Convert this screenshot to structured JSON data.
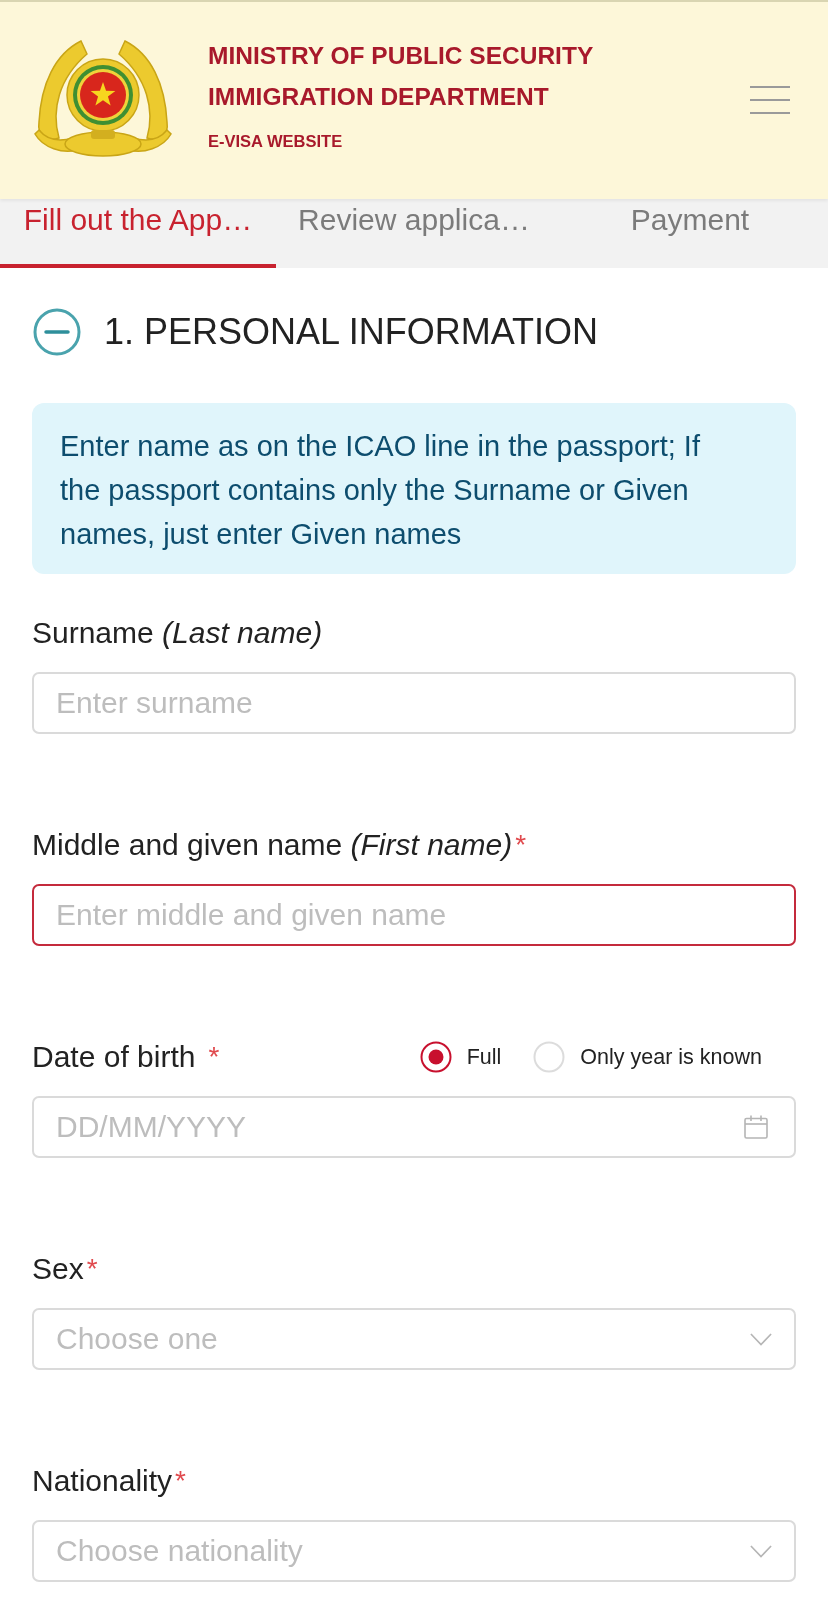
{
  "header": {
    "title_lines": [
      "MINISTRY OF PUBLIC SECURITY",
      "IMMIGRATION DEPARTMENT"
    ],
    "subtitle": "E-VISA WEBSITE"
  },
  "tabs": [
    {
      "label": "Fill out the App…",
      "selected": true
    },
    {
      "label": "Review applica…",
      "selected": false
    },
    {
      "label": "Payment",
      "selected": false
    }
  ],
  "section": {
    "title": "1. PERSONAL INFORMATION",
    "expanded": true,
    "notice": "Enter name as on the ICAO line in the passport; If the passport contains only the Surname or Given names, just enter Given names"
  },
  "fields": [
    {
      "kind": "text",
      "label": "Surname *(Last name)*",
      "invalid": false,
      "placeholder": "Enter surname"
    },
    {
      "kind": "text",
      "label": "Middle and given name *(First name)*",
      "required_mark": "*",
      "invalid": true,
      "placeholder": "Enter middle and given name"
    },
    {
      "kind": "date",
      "label": "Date of birth",
      "required_mark": "*",
      "options": [
        {
          "label": "Full",
          "selected": true
        },
        {
          "label": "Only year is known",
          "selected": false
        }
      ],
      "invalid": false,
      "placeholder": "DD/MM/YYYY"
    },
    {
      "kind": "select",
      "label": "Sex",
      "required_mark": "*",
      "invalid": false,
      "placeholder": "Choose one"
    },
    {
      "kind": "select",
      "label": "Nationality",
      "required_mark": "*",
      "invalid": false,
      "placeholder": "Choose nationality"
    }
  ]
}
